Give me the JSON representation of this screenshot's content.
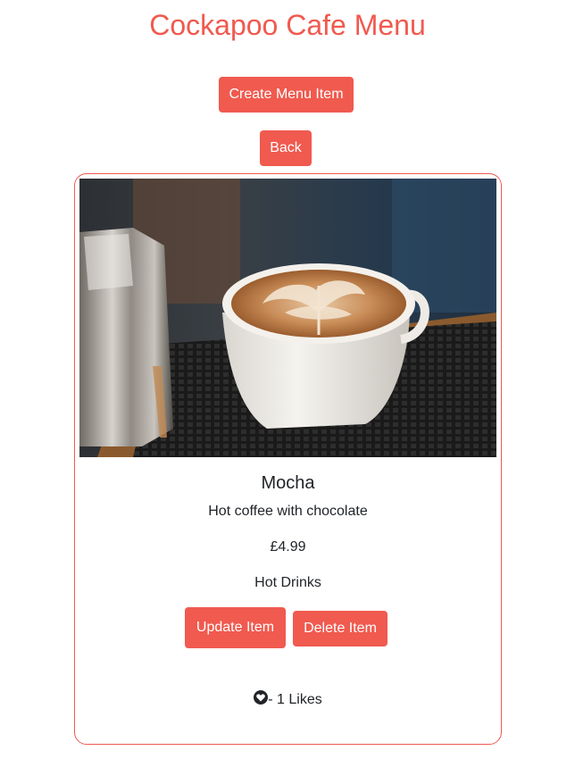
{
  "header": {
    "title": "Cockapoo Cafe Menu"
  },
  "actions": {
    "create_label": "Create Menu Item",
    "back_label": "Back"
  },
  "menu_item": {
    "image_alt": "latte-art-coffee-cup",
    "name": "Mocha",
    "description": "Hot coffee with chocolate",
    "price": "£4.99",
    "category": "Hot Drinks",
    "update_label": "Update Item",
    "delete_label": "Delete Item",
    "likes_text": "- 1 Likes",
    "like_icon": "heart-icon"
  },
  "colors": {
    "accent": "#f05a4f",
    "text": "#212529"
  }
}
